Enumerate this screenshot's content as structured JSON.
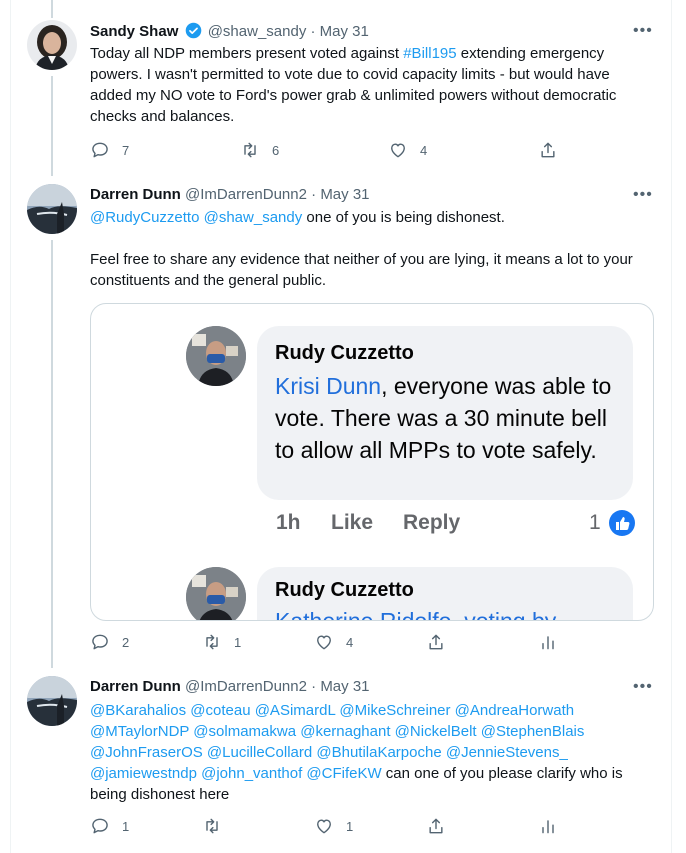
{
  "tweets": [
    {
      "name": "Sandy Shaw",
      "handle": "@shaw_sandy",
      "date": "May 31",
      "verified": true,
      "text_before": "Today all NDP members present voted against ",
      "hashtag": "#Bill195",
      "text_after": " extending emergency powers. I wasn't permitted to vote due to covid capacity limits - but would have added my NO vote to Ford's power grab & unlimited powers without democratic checks and balances.",
      "replies": "7",
      "retweets": "6",
      "likes": "4"
    },
    {
      "name": "Darren Dunn",
      "handle": "@ImDarrenDunn2",
      "date": "May 31",
      "mentions": "@RudyCuzzetto @shaw_sandy",
      "text_line1": " one of you is being dishonest.",
      "text_para2": "Feel free to share any evidence that neither of you are lying, it means a lot to your constituents and the general public.",
      "replies": "2",
      "retweets": "1",
      "likes": "4"
    },
    {
      "name": "Darren Dunn",
      "handle": "@ImDarrenDunn2",
      "date": "May 31",
      "mentions": "@BKarahalios @coteau @ASimardL @MikeSchreiner @AndreaHorwath @MTaylorNDP @solmamakwa @kernaghant @NickelBelt @StephenBlais @JohnFraserOS @LucilleCollard @BhutilaKarpoche @JennieStevens_ @jamiewestndp @john_vanthof @CFifeKW",
      "text_after": " can one of you please clarify who is being dishonest here",
      "replies": "1",
      "retweets": "",
      "likes": "1"
    }
  ],
  "embedded_screenshot": {
    "comment1": {
      "author": "Rudy Cuzzetto",
      "mention": "Krisi Dunn",
      "text": ", everyone was able to vote. There was a 30 minute bell to allow all MPPs to vote safely.",
      "time": "1h",
      "like_label": "Like",
      "reply_label": "Reply",
      "reaction_count": "1"
    },
    "comment2": {
      "author": "Rudy Cuzzetto",
      "partial_text": "Katherine Ridolfo, voting by"
    }
  },
  "more_glyph": "•••",
  "colors": {
    "link": "#1d9bf0",
    "verified": "#1d9bf0",
    "fb_link": "#216fdb"
  }
}
